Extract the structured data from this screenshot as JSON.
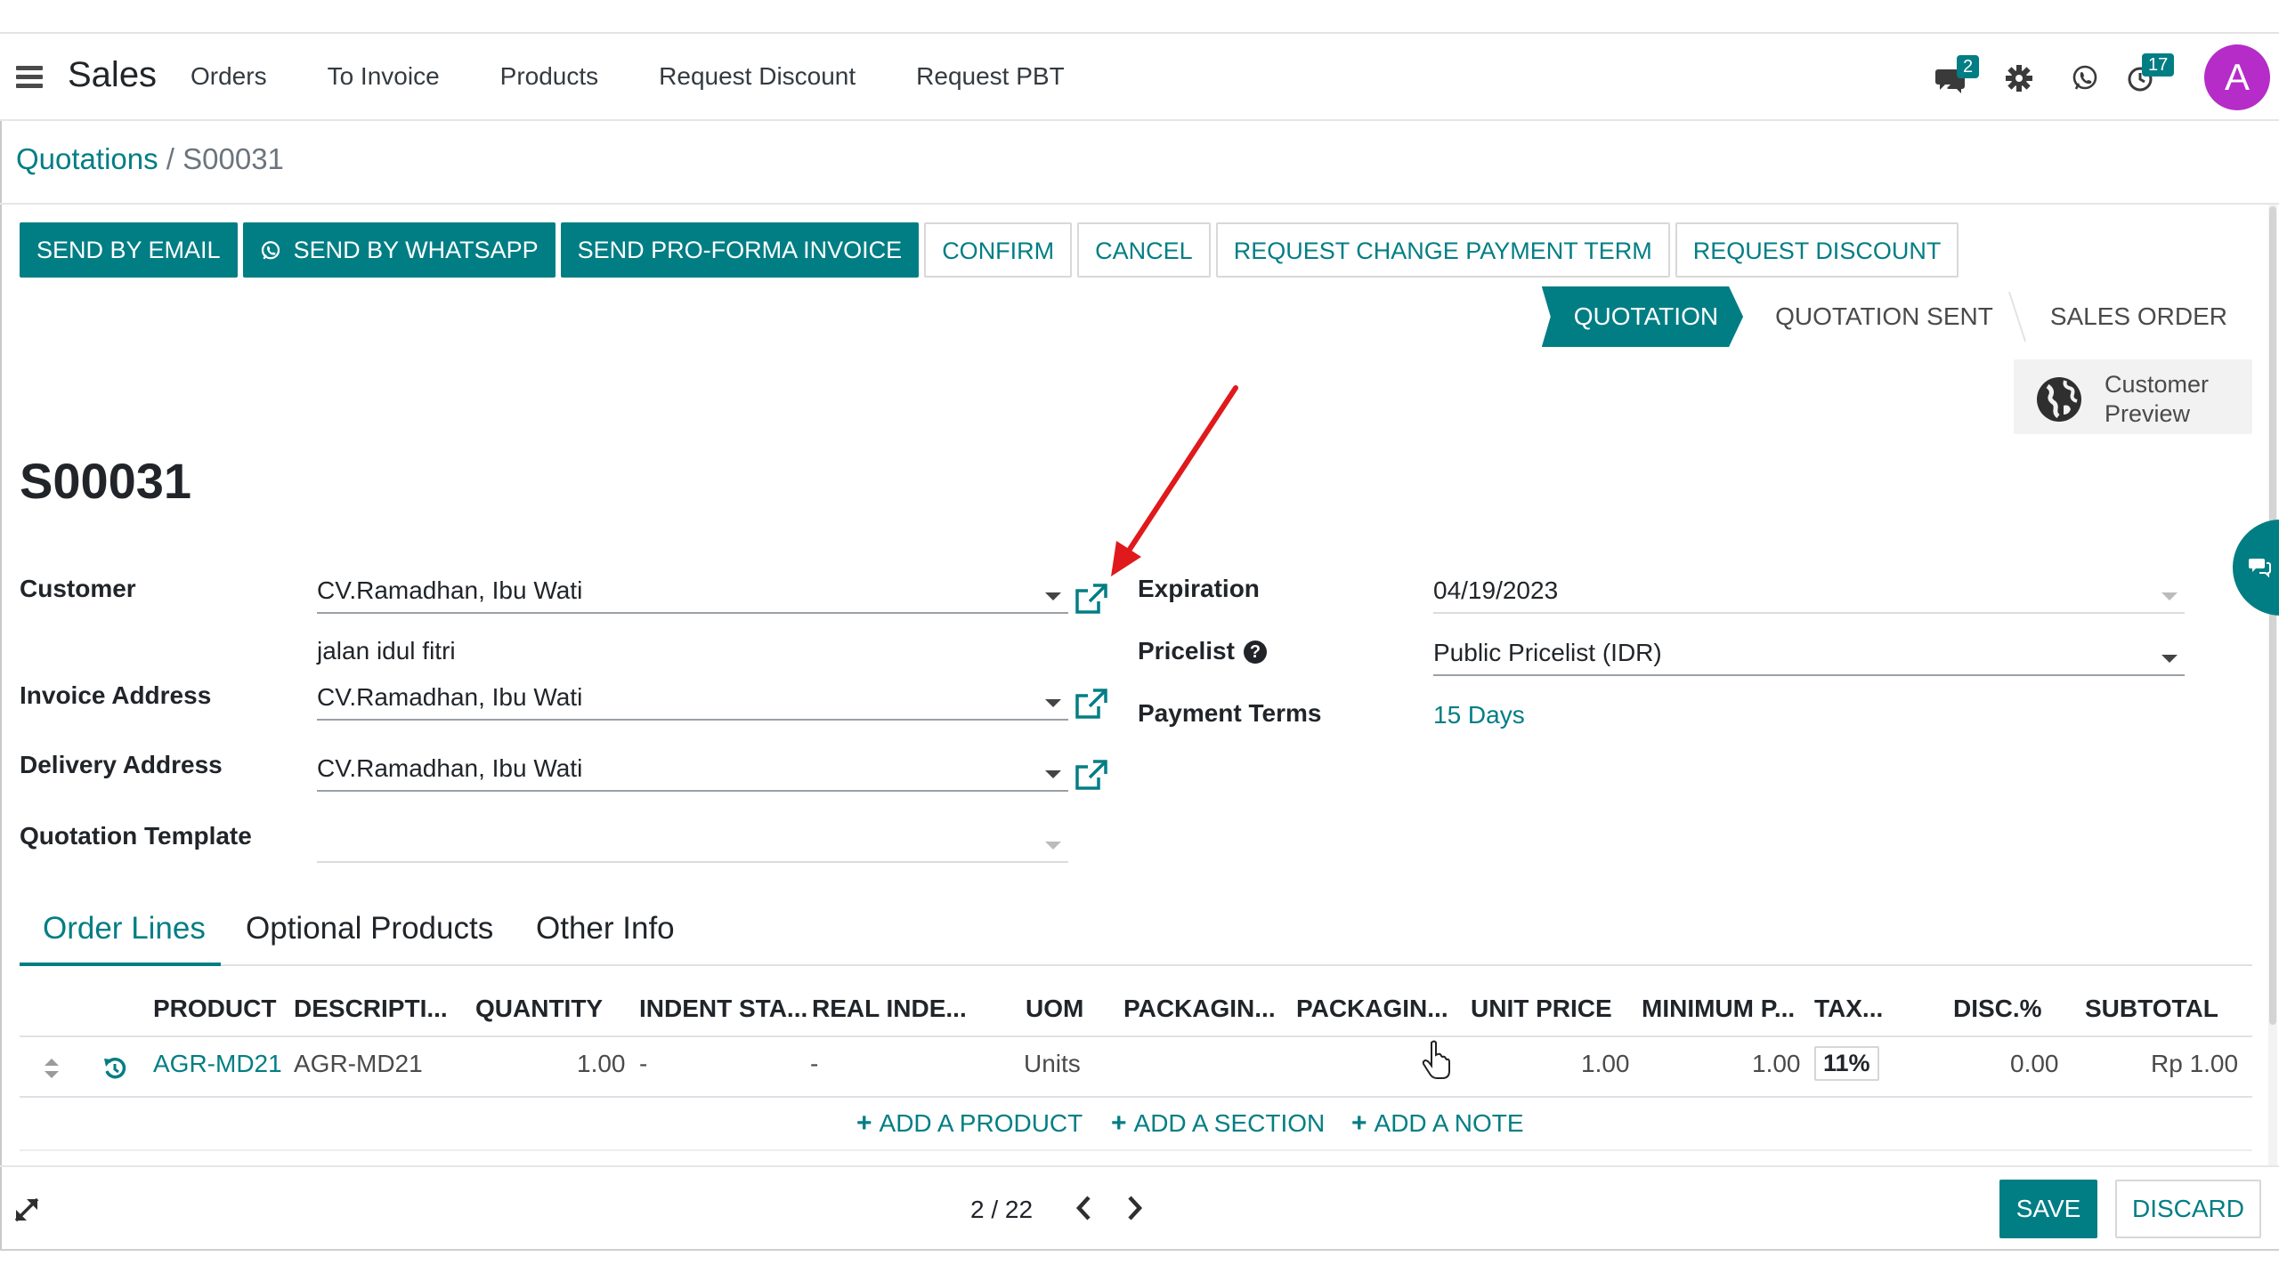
{
  "navbar": {
    "app_name": "Sales",
    "menu": [
      "Orders",
      "To Invoice",
      "Products",
      "Request Discount",
      "Request PBT"
    ],
    "messages_badge": "2",
    "activity_badge": "17",
    "avatar_letter": "A"
  },
  "breadcrumb": {
    "parent": "Quotations",
    "separator": " / ",
    "current": "S00031"
  },
  "actions": {
    "send_by_email": "SEND BY EMAIL",
    "send_by_whatsapp": "SEND BY WHATSAPP",
    "send_pro_forma": "SEND PRO-FORMA INVOICE",
    "confirm": "CONFIRM",
    "cancel": "CANCEL",
    "request_change_payment_term": "REQUEST CHANGE PAYMENT TERM",
    "request_discount": "REQUEST DISCOUNT"
  },
  "status": {
    "stages": [
      "QUOTATION",
      "QUOTATION SENT",
      "SALES ORDER"
    ],
    "active": "QUOTATION"
  },
  "customer_preview": {
    "line1": "Customer",
    "line2": "Preview"
  },
  "document": {
    "title": "S00031"
  },
  "form": {
    "customer_label": "Customer",
    "customer_value": "CV.Ramadhan, Ibu Wati",
    "customer_address": "jalan idul fitri",
    "invoice_address_label": "Invoice Address",
    "invoice_address_value": "CV.Ramadhan, Ibu Wati",
    "delivery_address_label": "Delivery Address",
    "delivery_address_value": "CV.Ramadhan, Ibu Wati",
    "quotation_template_label": "Quotation Template",
    "quotation_template_value": "",
    "expiration_label": "Expiration",
    "expiration_value": "04/19/2023",
    "pricelist_label": "Pricelist",
    "pricelist_value": "Public Pricelist (IDR)",
    "payment_terms_label": "Payment Terms",
    "payment_terms_value": "15 Days"
  },
  "tabs": [
    "Order Lines",
    "Optional Products",
    "Other Info"
  ],
  "table": {
    "headers": [
      "PRODUCT",
      "DESCRIPTI...",
      "QUANTITY",
      "INDENT STA...",
      "REAL INDE...",
      "UOM",
      "PACKAGIN...",
      "PACKAGIN...",
      "UNIT PRICE",
      "MINIMUM P...",
      "TAX...",
      "DISC.%",
      "SUBTOTAL"
    ],
    "rows": [
      {
        "product": "AGR-MD21",
        "description": "AGR-MD21",
        "quantity": "1.00",
        "indent_status": "-",
        "real_indent": "-",
        "uom": "Units",
        "unit_price": "1.00",
        "minimum_price": "1.00",
        "tax": "11%",
        "discount": "0.00",
        "subtotal": "Rp 1.00"
      }
    ],
    "add_product": "ADD A PRODUCT",
    "add_section": "ADD A SECTION",
    "add_note": "ADD A NOTE"
  },
  "pager": {
    "value": "2 / 22"
  },
  "footer": {
    "save": "SAVE",
    "discard": "DISCARD"
  },
  "colors": {
    "primary": "#017e84",
    "avatar": "#b62cc8",
    "annotation_arrow": "#e0191c"
  },
  "icons": [
    "menu-icon",
    "chat-icon",
    "gear-icon",
    "whatsapp-icon",
    "clock-icon",
    "external-link-icon",
    "globe-icon",
    "help-icon",
    "drag-handle-icon",
    "reset-icon",
    "plus-icon",
    "expand-icon",
    "chevron-left-icon",
    "chevron-right-icon"
  ]
}
